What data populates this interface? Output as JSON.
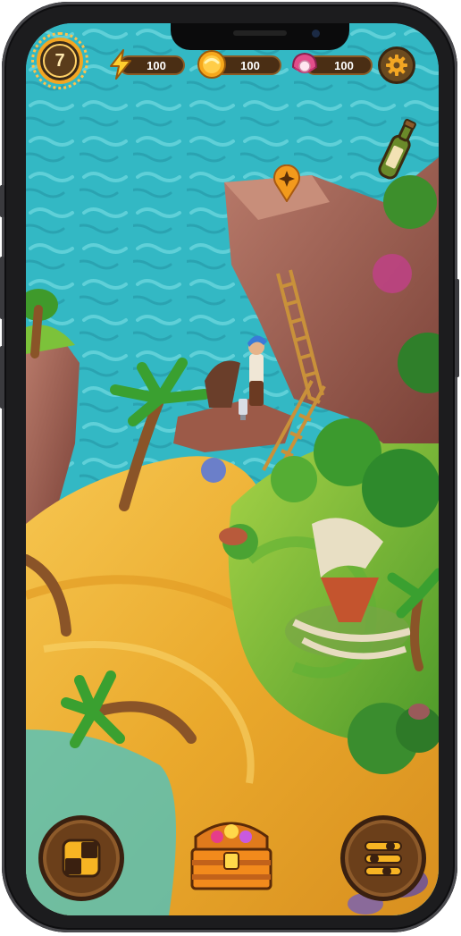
{
  "hud": {
    "level": "7",
    "energy": {
      "icon": "lightning-icon",
      "value": "100"
    },
    "coins": {
      "icon": "coin-icon",
      "value": "100"
    },
    "gems": {
      "icon": "pearl-shell-icon",
      "value": "100"
    },
    "settings_icon": "gear-icon"
  },
  "map": {
    "quest_marker_icon": "sparkle-map-pin-icon",
    "bottle_icon": "message-in-bottle-icon"
  },
  "bottom_bar": {
    "left_icon": "puzzle-grid-icon",
    "center_icon": "treasure-chest-icon",
    "right_icon": "menu-sliders-icon"
  },
  "colors": {
    "sea": "#33b8c4",
    "sand": "#f2b53a",
    "grass": "#7cc23a",
    "rock": "#9a5a50",
    "hud_pill": "#4a2e14",
    "accent_gold": "#f2a623"
  }
}
